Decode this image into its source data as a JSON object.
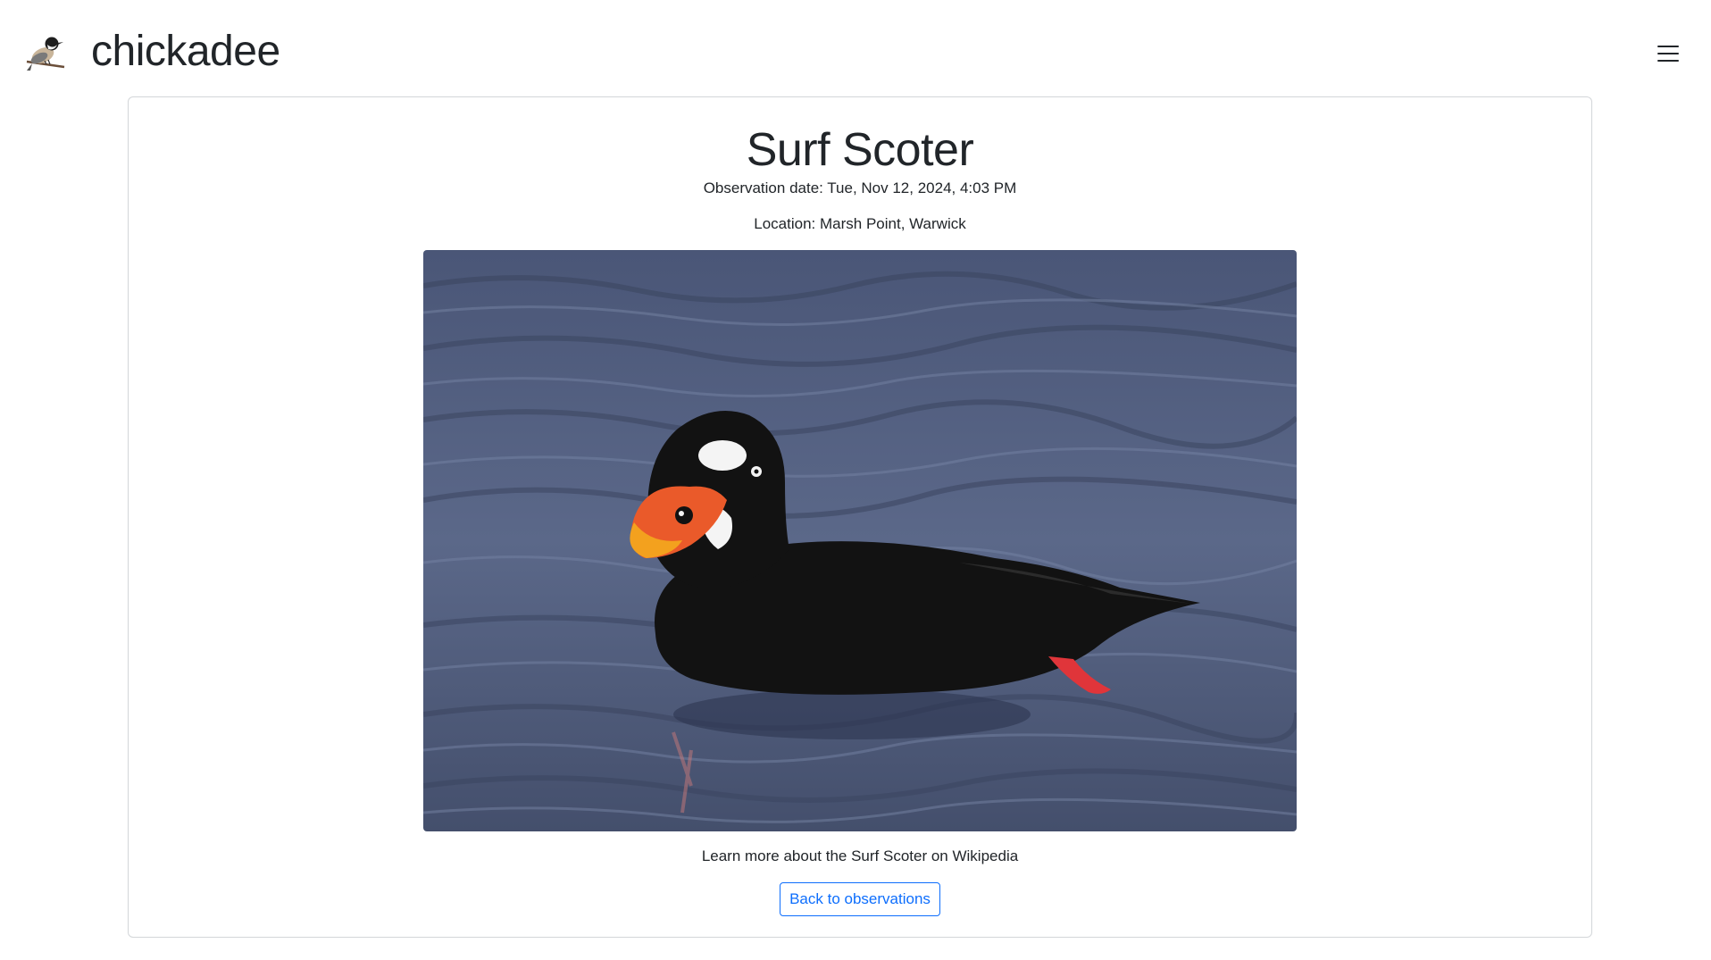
{
  "app": {
    "brand_name": "chickadee",
    "logo_icon": "chickadee-bird-icon",
    "menu_icon": "hamburger-menu-icon"
  },
  "observation": {
    "species": "Surf Scoter",
    "date_text": "Observation date: Tue, Nov 12, 2024, 4:03 PM",
    "location_text": "Location: Marsh Point, Warwick",
    "wiki_link_text": "Learn more about the Surf Scoter on Wikipedia",
    "back_button_label": "Back to observations"
  },
  "colors": {
    "accent": "#0d6efd",
    "card_border": "#d3d6d9",
    "water": "#4f5d7d"
  }
}
